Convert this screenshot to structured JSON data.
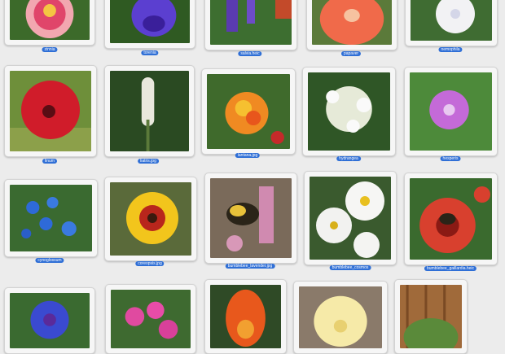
{
  "gallery": {
    "items": [
      {
        "filename": "zinnia"
      },
      {
        "filename": "torenia"
      },
      {
        "filename": "salvia.heic"
      },
      {
        "filename": "papaver"
      },
      {
        "filename": "nemophila"
      },
      {
        "filename": "linum"
      },
      {
        "filename": "liatris.jpg"
      },
      {
        "filename": "lantana.jpg"
      },
      {
        "filename": "hydrangea"
      },
      {
        "filename": "hesperis"
      },
      {
        "filename": "cynoglossum"
      },
      {
        "filename": "coreopsis.jpg"
      },
      {
        "filename": "bumblebee_lavender.jpg"
      },
      {
        "filename": "bumblebee_cosmos"
      },
      {
        "filename": "bumblebee_gaillardia.heic"
      },
      {
        "filename": ""
      },
      {
        "filename": ""
      },
      {
        "filename": ""
      },
      {
        "filename": ""
      },
      {
        "filename": ""
      }
    ]
  }
}
